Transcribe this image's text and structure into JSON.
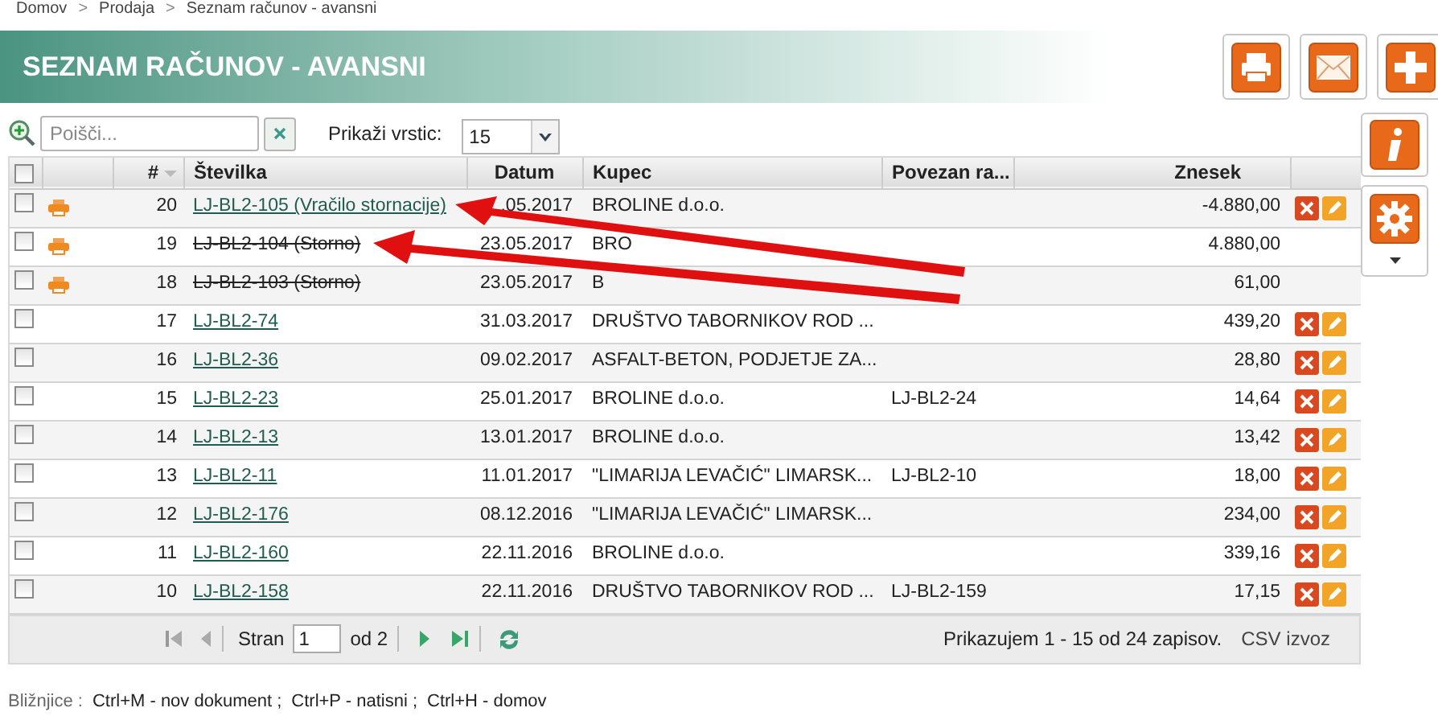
{
  "breadcrumb": [
    {
      "kind": "link",
      "text": "Domov"
    },
    {
      "kind": "separator",
      "text": ">"
    },
    {
      "kind": "link",
      "text": "Prodaja"
    },
    {
      "kind": "separator",
      "text": ">"
    },
    {
      "kind": "link",
      "text": "Seznam računov - avansni"
    }
  ],
  "title": "SEZNAM RAČUNOV - AVANSNI",
  "toolbar": {
    "search": {
      "placeholder": "Poišči..."
    },
    "rows_label": "Prikaži vrstic:",
    "rows_value": "15"
  },
  "table": {
    "all_selected": false,
    "columns": [
      "#",
      "Številka",
      "Datum",
      "Kupec",
      "Povezan ra...",
      "Znesek"
    ],
    "rows": [
      {
        "selected": false,
        "printable": true,
        "number": "20",
        "document": "LJ-BL2-105 (Vračilo stornacije)",
        "cancelled": false,
        "date": ".05.2017",
        "customer": "BROLINE d.o.o.",
        "linked": "",
        "amount": "-4.880,00",
        "editable": true
      },
      {
        "selected": false,
        "printable": true,
        "number": "19",
        "document": "LJ-BL2-104 (Storno)",
        "cancelled": true,
        "date": "23.05.2017",
        "customer": "BRO",
        "linked": "",
        "amount": "4.880,00",
        "editable": false
      },
      {
        "selected": false,
        "printable": true,
        "number": "18",
        "document": "LJ-BL2-103 (Storno)",
        "cancelled": true,
        "date": "23.05.2017",
        "customer": "B",
        "linked": "",
        "amount": "61,00",
        "editable": false
      },
      {
        "selected": false,
        "printable": false,
        "number": "17",
        "document": "LJ-BL2-74",
        "cancelled": false,
        "date": "31.03.2017",
        "customer": "DRUŠTVO TABORNIKOV ROD ...",
        "linked": "",
        "amount": "439,20",
        "editable": true
      },
      {
        "selected": false,
        "printable": false,
        "number": "16",
        "document": "LJ-BL2-36",
        "cancelled": false,
        "date": "09.02.2017",
        "customer": "ASFALT-BETON, PODJETJE ZA...",
        "linked": "",
        "amount": "28,80",
        "editable": true
      },
      {
        "selected": false,
        "printable": false,
        "number": "15",
        "document": "LJ-BL2-23",
        "cancelled": false,
        "date": "25.01.2017",
        "customer": "BROLINE d.o.o.",
        "linked": "LJ-BL2-24",
        "amount": "14,64",
        "editable": true
      },
      {
        "selected": false,
        "printable": false,
        "number": "14",
        "document": "LJ-BL2-13",
        "cancelled": false,
        "date": "13.01.2017",
        "customer": "BROLINE d.o.o.",
        "linked": "",
        "amount": "13,42",
        "editable": true
      },
      {
        "selected": false,
        "printable": false,
        "number": "13",
        "document": "LJ-BL2-11",
        "cancelled": false,
        "date": "11.01.2017",
        "customer": "\"LIMARIJA LEVAČIĆ\" LIMARSK...",
        "linked": "LJ-BL2-10",
        "amount": "18,00",
        "editable": true
      },
      {
        "selected": false,
        "printable": false,
        "number": "12",
        "document": "LJ-BL2-176",
        "cancelled": false,
        "date": "08.12.2016",
        "customer": "\"LIMARIJA LEVAČIĆ\" LIMARSK...",
        "linked": "",
        "amount": "234,00",
        "editable": true
      },
      {
        "selected": false,
        "printable": false,
        "number": "11",
        "document": "LJ-BL2-160",
        "cancelled": false,
        "date": "22.11.2016",
        "customer": "BROLINE d.o.o.",
        "linked": "",
        "amount": "339,16",
        "editable": true
      },
      {
        "selected": false,
        "printable": false,
        "number": "10",
        "document": "LJ-BL2-158",
        "cancelled": false,
        "date": "22.11.2016",
        "customer": "DRUŠTVO TABORNIKOV ROD ...",
        "linked": "LJ-BL2-159",
        "amount": "17,15",
        "editable": true
      }
    ]
  },
  "pager": {
    "page_label": "Stran",
    "page": "1",
    "of": "od 2",
    "summary": "Prikazujem 1 - 15 od 24 zapisov.",
    "export": "CSV izvoz"
  },
  "shortcuts": {
    "label": "Bližnjice :",
    "items": [
      "Ctrl+M - nov dokument ;",
      "Ctrl+P - natisni ;",
      "Ctrl+H - domov"
    ]
  }
}
